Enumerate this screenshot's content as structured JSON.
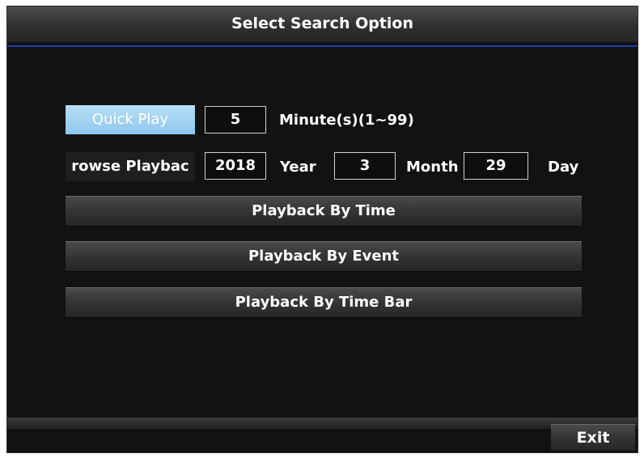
{
  "window": {
    "title": "Select Search Option"
  },
  "quick_play": {
    "button_label": "Quick Play",
    "minutes_value": "5",
    "minutes_unit": "Minute(s)(1~99)"
  },
  "browse": {
    "button_label": "rowse Playbac",
    "year_value": "2018",
    "year_label": "Year",
    "month_value": "3",
    "month_label": "Month",
    "day_value": "29",
    "day_label": "Day"
  },
  "actions": {
    "by_time": "Playback By Time",
    "by_event": "Playback By Event",
    "by_time_bar": "Playback By Time Bar"
  },
  "footer": {
    "exit_label": "Exit"
  },
  "colors": {
    "accent_rule": "#1f3fa8",
    "selected_button": "#9fd2f2"
  }
}
